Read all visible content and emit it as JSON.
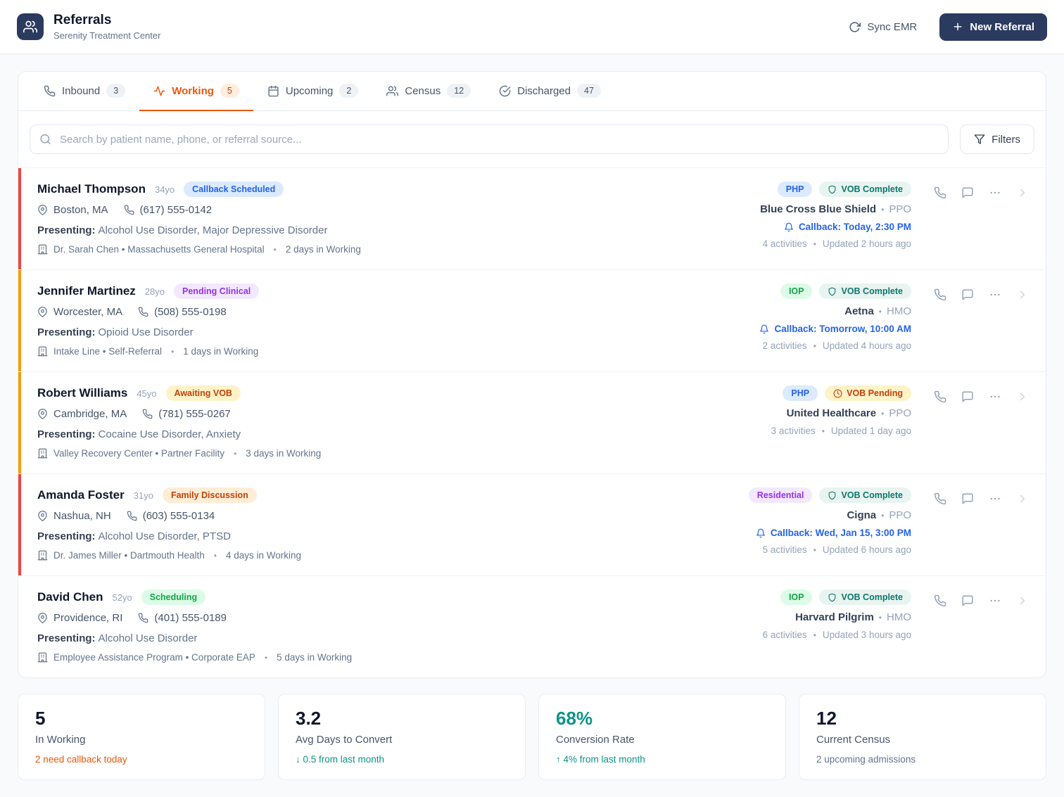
{
  "ui": {
    "bullet": "•",
    "presenting_label": "Presenting:"
  },
  "header": {
    "title": "Referrals",
    "subtitle": "Serenity Treatment Center",
    "sync_label": "Sync EMR",
    "new_referral_label": "New Referral",
    "brand_color": "#2b3a5f"
  },
  "tabs": [
    {
      "label": "Inbound",
      "count": "3",
      "icon": "phone-icon",
      "state": "inactive"
    },
    {
      "label": "Working",
      "count": "5",
      "icon": "activity-icon",
      "state": "active"
    },
    {
      "label": "Upcoming",
      "count": "2",
      "icon": "calendar-icon",
      "state": "inactive"
    },
    {
      "label": "Census",
      "count": "12",
      "icon": "users-icon",
      "state": "inactive"
    },
    {
      "label": "Discharged",
      "count": "47",
      "icon": "check-circle-icon",
      "state": "inactive"
    }
  ],
  "search": {
    "placeholder": "Search by patient name, phone, or referral source...",
    "filters_label": "Filters"
  },
  "referrals": [
    {
      "name": "Michael Thompson",
      "age": "34yo",
      "status": {
        "label": "Callback Scheduled",
        "tone": "blue"
      },
      "location": "Boston, MA",
      "phone": "(617) 555-0142",
      "presenting": "Alcohol Use Disorder, Major Depressive Disorder",
      "source": "Dr. Sarah Chen • Massachusetts General Hospital",
      "days": "2 days in Working",
      "accent": "red",
      "level": {
        "label": "PHP",
        "tone": "blue"
      },
      "vob": {
        "label": "VOB Complete",
        "state": "complete"
      },
      "insurance": "Blue Cross Blue Shield",
      "plan": "PPO",
      "callback": "Callback: Today, 2:30 PM",
      "activities": "4 activities",
      "updated": "Updated 2 hours ago"
    },
    {
      "name": "Jennifer Martinez",
      "age": "28yo",
      "status": {
        "label": "Pending Clinical",
        "tone": "purple"
      },
      "location": "Worcester, MA",
      "phone": "(508) 555-0198",
      "presenting": "Opioid Use Disorder",
      "source": "Intake Line • Self-Referral",
      "days": "1 days in Working",
      "accent": "amber",
      "level": {
        "label": "IOP",
        "tone": "green"
      },
      "vob": {
        "label": "VOB Complete",
        "state": "complete"
      },
      "insurance": "Aetna",
      "plan": "HMO",
      "callback": "Callback: Tomorrow, 10:00 AM",
      "activities": "2 activities",
      "updated": "Updated 4 hours ago"
    },
    {
      "name": "Robert Williams",
      "age": "45yo",
      "status": {
        "label": "Awaiting VOB",
        "tone": "amber"
      },
      "location": "Cambridge, MA",
      "phone": "(781) 555-0267",
      "presenting": "Cocaine Use Disorder, Anxiety",
      "source": "Valley Recovery Center • Partner Facility",
      "days": "3 days in Working",
      "accent": "amber",
      "level": {
        "label": "PHP",
        "tone": "blue"
      },
      "vob": {
        "label": "VOB Pending",
        "state": "pending"
      },
      "insurance": "United Healthcare",
      "plan": "PPO",
      "callback": "",
      "activities": "3 activities",
      "updated": "Updated 1 day ago"
    },
    {
      "name": "Amanda Foster",
      "age": "31yo",
      "status": {
        "label": "Family Discussion",
        "tone": "peach"
      },
      "location": "Nashua, NH",
      "phone": "(603) 555-0134",
      "presenting": "Alcohol Use Disorder, PTSD",
      "source": "Dr. James Miller • Dartmouth Health",
      "days": "4 days in Working",
      "accent": "red",
      "level": {
        "label": "Residential",
        "tone": "purple"
      },
      "vob": {
        "label": "VOB Complete",
        "state": "complete"
      },
      "insurance": "Cigna",
      "plan": "PPO",
      "callback": "Callback: Wed, Jan 15, 3:00 PM",
      "activities": "5 activities",
      "updated": "Updated 6 hours ago"
    },
    {
      "name": "David Chen",
      "age": "52yo",
      "status": {
        "label": "Scheduling",
        "tone": "green"
      },
      "location": "Providence, RI",
      "phone": "(401) 555-0189",
      "presenting": "Alcohol Use Disorder",
      "source": "Employee Assistance Program • Corporate EAP",
      "days": "5 days in Working",
      "accent": "none",
      "level": {
        "label": "IOP",
        "tone": "green"
      },
      "vob": {
        "label": "VOB Complete",
        "state": "complete"
      },
      "insurance": "Harvard Pilgrim",
      "plan": "HMO",
      "callback": "",
      "activities": "6 activities",
      "updated": "Updated 3 hours ago"
    }
  ],
  "stats": [
    {
      "value": "5",
      "tone": "dark",
      "label": "In Working",
      "note": "2 need callback today",
      "note_tone": "orange"
    },
    {
      "value": "3.2",
      "tone": "dark",
      "label": "Avg Days to Convert",
      "note": "↓ 0.5 from last month",
      "note_tone": "teal"
    },
    {
      "value": "68%",
      "tone": "teal",
      "label": "Conversion Rate",
      "note": "↑ 4% from last month",
      "note_tone": "teal"
    },
    {
      "value": "12",
      "tone": "dark",
      "label": "Current Census",
      "note": "2 upcoming admissions",
      "note_tone": "gray"
    }
  ]
}
